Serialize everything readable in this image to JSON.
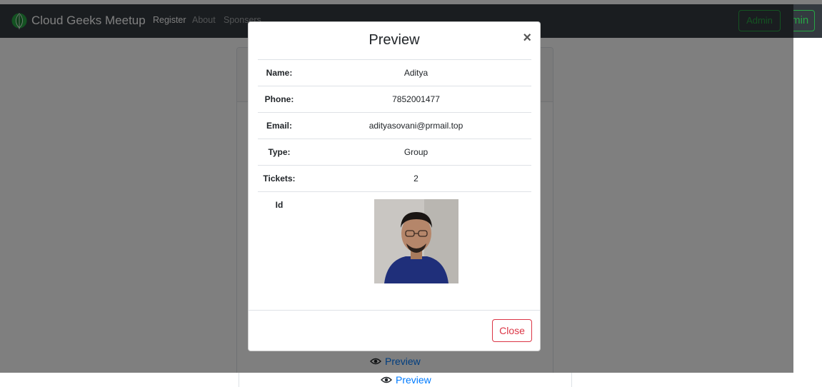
{
  "navbar": {
    "brand": "Cloud Geeks Meetup",
    "links": [
      "Register",
      "About",
      "Sponsers"
    ],
    "admin_label": "Admin"
  },
  "page": {
    "preview_label": "Preview"
  },
  "modal": {
    "title": "Preview",
    "close_symbol": "×",
    "rows": [
      {
        "label": "Name:",
        "value": "Aditya"
      },
      {
        "label": "Phone:",
        "value": "7852001477"
      },
      {
        "label": "Email:",
        "value": "adityasovani@prmail.top"
      },
      {
        "label": "Type:",
        "value": "Group"
      },
      {
        "label": "Tickets:",
        "value": "2"
      }
    ],
    "id_label": "Id",
    "close_button": "Close"
  },
  "colors": {
    "navbar": "#343a40",
    "success": "#28a745",
    "danger": "#dc3545",
    "link": "#007bff"
  },
  "icons": [
    "leaf-logo-icon",
    "eye-icon",
    "close-icon"
  ]
}
